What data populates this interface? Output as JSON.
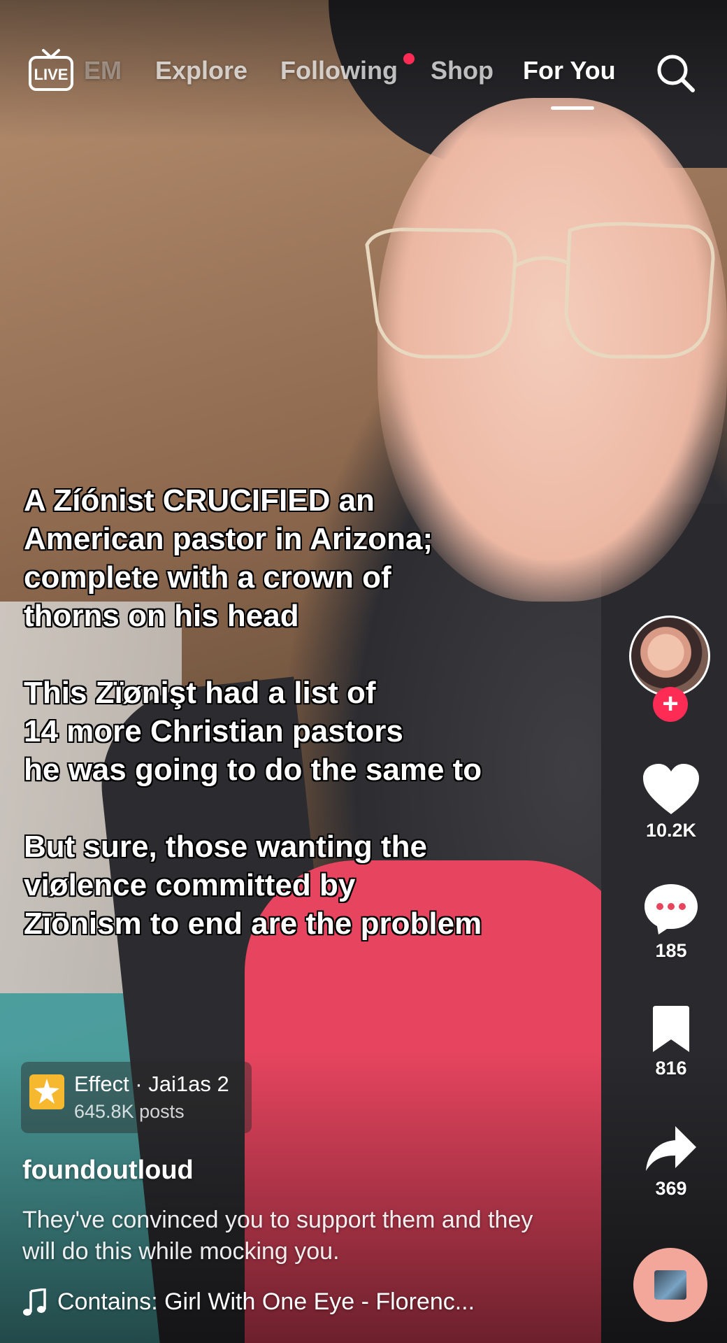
{
  "top_nav": {
    "live_label": "LIVE",
    "tabs": [
      {
        "label": "EM"
      },
      {
        "label": "Explore"
      },
      {
        "label": "Following"
      },
      {
        "label": "Shop"
      },
      {
        "label": "For You"
      }
    ],
    "active_tab": "For You"
  },
  "overlay_text": {
    "paragraphs": [
      "A Zíónist CRUCIFIED an\nAmerican pastor in Arizona;\ncomplete with a crown of\nthorns on his head",
      "This Zïønişt had a list of\n14 more Christian pastors\nhe was going to do the same to",
      "But sure, those wanting the\nviølence committed by\nZīōnism to end are the problem"
    ]
  },
  "actions": {
    "likes": "10.2K",
    "comments": "185",
    "bookmarks": "816",
    "shares": "369",
    "follow_symbol": "+"
  },
  "effect": {
    "name": "Effect · Jai1as 2",
    "posts": "645.8K posts"
  },
  "post": {
    "username": "foundoutloud",
    "caption": "They've convinced you to support them and they will do this while mocking you.",
    "music": "Contains: Girl With One Eye - Florenc..."
  },
  "colors": {
    "accent": "#fe2c55",
    "effect_icon": "#f5b82e",
    "music_disc": "#f3a79b"
  },
  "icons": [
    "live-icon",
    "search-icon",
    "heart-icon",
    "comment-icon",
    "bookmark-icon",
    "share-icon",
    "music-note-icon",
    "effect-icon"
  ]
}
